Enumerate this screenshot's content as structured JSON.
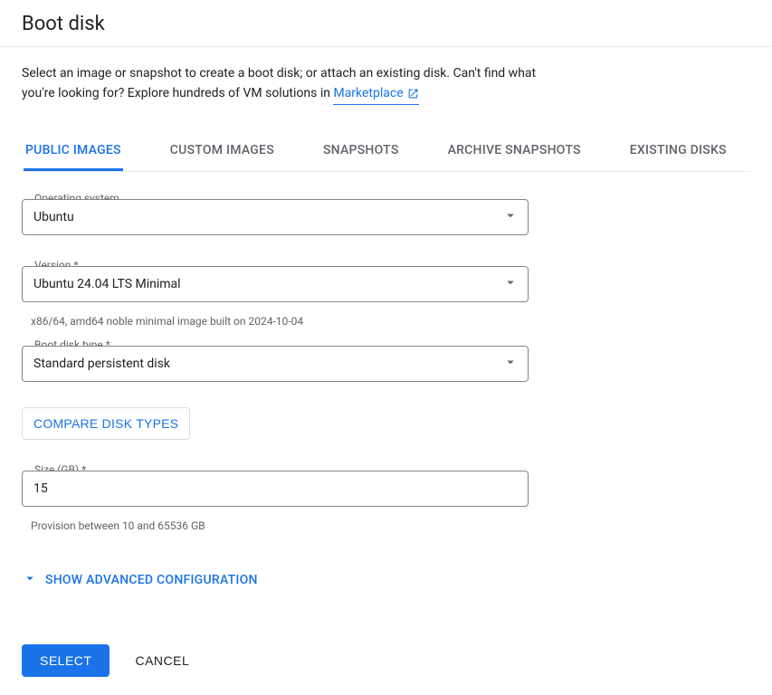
{
  "dialog": {
    "title": "Boot disk"
  },
  "intro": {
    "text_a": "Select an image or snapshot to create a boot disk; or attach an existing disk. Can't find what you're looking for? Explore hundreds of VM solutions in ",
    "link_label": "Marketplace"
  },
  "tabs": [
    {
      "label": "PUBLIC IMAGES",
      "active": true
    },
    {
      "label": "CUSTOM IMAGES",
      "active": false
    },
    {
      "label": "SNAPSHOTS",
      "active": false
    },
    {
      "label": "ARCHIVE SNAPSHOTS",
      "active": false
    },
    {
      "label": "EXISTING DISKS",
      "active": false
    }
  ],
  "fields": {
    "os": {
      "label": "Operating system",
      "value": "Ubuntu"
    },
    "version": {
      "label": "Version *",
      "value": "Ubuntu 24.04 LTS Minimal",
      "helper": "x86/64, amd64 noble minimal image built on 2024-10-04"
    },
    "disk_type": {
      "label": "Boot disk type *",
      "value": "Standard persistent disk"
    },
    "size": {
      "label": "Size (GB) *",
      "value": "15",
      "helper": "Provision between 10 and 65536 GB"
    }
  },
  "compare_btn": "COMPARE DISK TYPES",
  "advanced_toggle": "SHOW ADVANCED CONFIGURATION",
  "actions": {
    "select": "SELECT",
    "cancel": "CANCEL"
  }
}
